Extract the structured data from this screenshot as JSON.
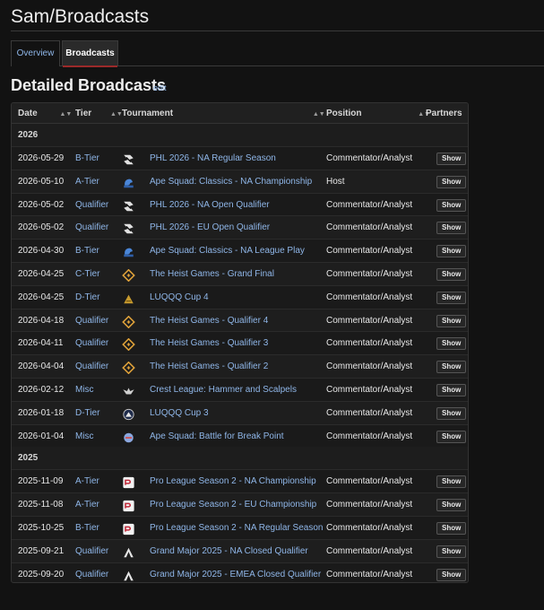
{
  "page": {
    "title": "Sam/Broadcasts",
    "tabs": [
      {
        "label": "Overview"
      },
      {
        "label": "Broadcasts"
      }
    ],
    "section_heading": "Detailed Broadcasts",
    "edit_label": "edit"
  },
  "table": {
    "headers": {
      "date": "Date",
      "tier": "Tier",
      "tournament": "Tournament",
      "position": "Position",
      "partners": "Partners"
    },
    "sort_glyph": "▲▼",
    "show_label": "Show",
    "groups": [
      {
        "year": "2026",
        "rows": [
          {
            "date": "2026-05-29",
            "tier": "B-Tier",
            "icon": "phl-icon",
            "tournament": "PHL 2026 - NA Regular Season",
            "position": "Commentator/Analyst"
          },
          {
            "date": "2026-05-10",
            "tier": "A-Tier",
            "icon": "ape-squad-classics-icon",
            "tournament": "Ape Squad: Classics - NA Championship",
            "position": "Host"
          },
          {
            "date": "2026-05-02",
            "tier": "Qualifier",
            "icon": "phl-icon",
            "tournament": "PHL 2026 - NA Open Qualifier",
            "position": "Commentator/Analyst"
          },
          {
            "date": "2026-05-02",
            "tier": "Qualifier",
            "icon": "phl-icon",
            "tournament": "PHL 2026 - EU Open Qualifier",
            "position": "Commentator/Analyst"
          },
          {
            "date": "2026-04-30",
            "tier": "B-Tier",
            "icon": "ape-squad-classics-icon",
            "tournament": "Ape Squad: Classics - NA League Play",
            "position": "Commentator/Analyst"
          },
          {
            "date": "2026-04-25",
            "tier": "C-Tier",
            "icon": "heist-games-icon",
            "tournament": "The Heist Games - Grand Final",
            "position": "Commentator/Analyst"
          },
          {
            "date": "2026-04-25",
            "tier": "D-Tier",
            "icon": "luqqq-cup-icon",
            "tournament": "LUQQQ Cup 4",
            "position": "Commentator/Analyst"
          },
          {
            "date": "2026-04-18",
            "tier": "Qualifier",
            "icon": "heist-games-icon",
            "tournament": "The Heist Games - Qualifier 4",
            "position": "Commentator/Analyst"
          },
          {
            "date": "2026-04-11",
            "tier": "Qualifier",
            "icon": "heist-games-icon",
            "tournament": "The Heist Games - Qualifier 3",
            "position": "Commentator/Analyst"
          },
          {
            "date": "2026-04-04",
            "tier": "Qualifier",
            "icon": "heist-games-icon",
            "tournament": "The Heist Games - Qualifier 2",
            "position": "Commentator/Analyst"
          },
          {
            "date": "2026-02-12",
            "tier": "Misc",
            "icon": "crest-league-icon",
            "tournament": "Crest League: Hammer and Scalpels",
            "position": "Commentator/Analyst"
          },
          {
            "date": "2026-01-18",
            "tier": "D-Tier",
            "icon": "luqqq-cup-3-icon",
            "tournament": "LUQQQ Cup 3",
            "position": "Commentator/Analyst"
          },
          {
            "date": "2026-01-04",
            "tier": "Misc",
            "icon": "ape-squad-icon",
            "tournament": "Ape Squad: Battle for Break Point",
            "position": "Commentator/Analyst"
          }
        ]
      },
      {
        "year": "2025",
        "rows": [
          {
            "date": "2025-11-09",
            "tier": "A-Tier",
            "icon": "pro-league-icon",
            "tournament": "Pro League Season 2 - NA Championship",
            "position": "Commentator/Analyst"
          },
          {
            "date": "2025-11-08",
            "tier": "A-Tier",
            "icon": "pro-league-icon",
            "tournament": "Pro League Season 2 - EU Championship",
            "position": "Commentator/Analyst"
          },
          {
            "date": "2025-10-25",
            "tier": "B-Tier",
            "icon": "pro-league-icon",
            "tournament": "Pro League Season 2 - NA Regular Season",
            "position": "Commentator/Analyst"
          },
          {
            "date": "2025-09-21",
            "tier": "Qualifier",
            "icon": "grand-major-icon",
            "tournament": "Grand Major 2025 - NA Closed Qualifier",
            "position": "Commentator/Analyst"
          },
          {
            "date": "2025-09-20",
            "tier": "Qualifier",
            "icon": "grand-major-icon",
            "tournament": "Grand Major 2025 - EMEA Closed Qualifier",
            "position": "Commentator/Analyst"
          }
        ]
      }
    ]
  }
}
